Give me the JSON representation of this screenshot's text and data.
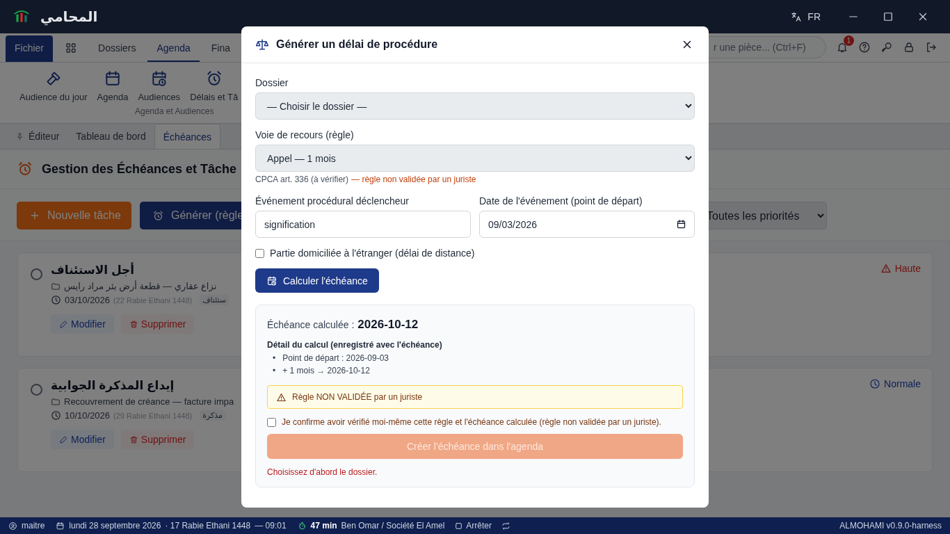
{
  "titlebar": {
    "app_name": "المحامي",
    "language": "FR"
  },
  "ribbon": {
    "tabs": [
      {
        "kind": "file",
        "label": "Fichier",
        "selected": false
      },
      {
        "kind": "apps",
        "selected": false
      },
      {
        "kind": "text",
        "label": "Dossiers",
        "selected": false
      },
      {
        "kind": "text",
        "label": "Agenda",
        "selected": true
      },
      {
        "kind": "text",
        "label": "Fina",
        "selected": false
      }
    ],
    "search": {
      "placeholder": "r une pièce... (Ctrl+F)"
    },
    "notifications": {
      "count": "1"
    }
  },
  "ribbon_group": {
    "label": "Agenda et Audiences",
    "buttons": [
      {
        "kind": "gavel",
        "label": "Audience du jour"
      },
      {
        "kind": "calendar",
        "label": "Agenda"
      },
      {
        "kind": "calendar-clock",
        "label": "Audiences"
      },
      {
        "kind": "alarm",
        "label": "Délais et Tâ"
      }
    ]
  },
  "document_tabs": [
    {
      "label": "Éditeur",
      "pinned": true,
      "selected": false
    },
    {
      "label": "Tableau de bord",
      "pinned": false,
      "selected": false
    },
    {
      "label": "Échéances",
      "pinned": false,
      "selected": true
    }
  ],
  "page": {
    "title": "Gestion des Échéances et Tâche"
  },
  "toolbar": {
    "buttons": [
      {
        "kind": "new",
        "label": "Nouvelle tâche"
      },
      {
        "kind": "generate",
        "label": "Générer (règle"
      }
    ],
    "priority_filter": "Toutes les priorités"
  },
  "tasks": [
    {
      "title": "أجل الاستئناف",
      "done": false,
      "dossier": "نزاع عقاري — قطعة أرض بئر مراد رايس",
      "date": "03/10/2026",
      "hijri": "(22 Rabie Ethani 1448)",
      "tag": "ستئناف",
      "priority": "Haute",
      "kind": "high",
      "actions": [
        "Modifier",
        "Supprimer"
      ]
    },
    {
      "title": "إيداع المذكرة الجوابية",
      "done": false,
      "dossier": "Recouvrement de créance — facture impa",
      "date": "10/10/2026",
      "hijri": "(29 Rabie Ethani 1448)",
      "tag": "مذكرة",
      "priority": "Normale",
      "kind": "normal",
      "actions": [
        "Modifier",
        "Supprimer"
      ]
    }
  ],
  "dialog": {
    "title": "Générer un délai de procédure",
    "dossier": {
      "label": "Dossier",
      "value": "— Choisir le dossier —"
    },
    "rule": {
      "label": "Voie de recours (règle)",
      "value": "Appel — 1 mois",
      "note": "CPCA art. 336 (à vérifier)",
      "warning": "— règle non validée par un juriste"
    },
    "event": {
      "label": "Événement procédural déclencheur",
      "value": "signification"
    },
    "event_date": {
      "label": "Date de l'événement (point de départ)",
      "value": "09/03/2026"
    },
    "abroad": {
      "label": "Partie domiciliée à l'étranger (délai de distance)",
      "checked": false
    },
    "calculate_button": "Calculer l'échéance",
    "result": {
      "label": "Échéance calculée :",
      "value": "2026-10-12",
      "detail_title": "Détail du calcul (enregistré avec l'échéance)",
      "steps": [
        {
          "bullet": "•",
          "text": "Point de départ : 2026-09-03"
        },
        {
          "bullet": "•",
          "text": "+ 1 mois → 2026-10-12"
        }
      ],
      "alert": "Règle NON VALIDÉE par un juriste",
      "confirm": {
        "label": "Je confirme avoir vérifié moi-même cette règle et l'échéance calculée (règle non validée par un juriste).",
        "checked": false
      },
      "create_button": {
        "label": "Créer l'échéance dans l'agenda",
        "disabled": true
      },
      "error": "Choisissez d'abord le dossier."
    }
  },
  "status_bar": {
    "user": "maitre",
    "date": "lundi 28 septembre 2026",
    "hijri": "· 17 Rabie Ethani 1448",
    "time": "— 09:01",
    "timer": "47 min",
    "client": "Ben Omar / Société El Amel",
    "stop": "Arrêter",
    "version": "ALMOHAMI v0.9.0-harness"
  }
}
